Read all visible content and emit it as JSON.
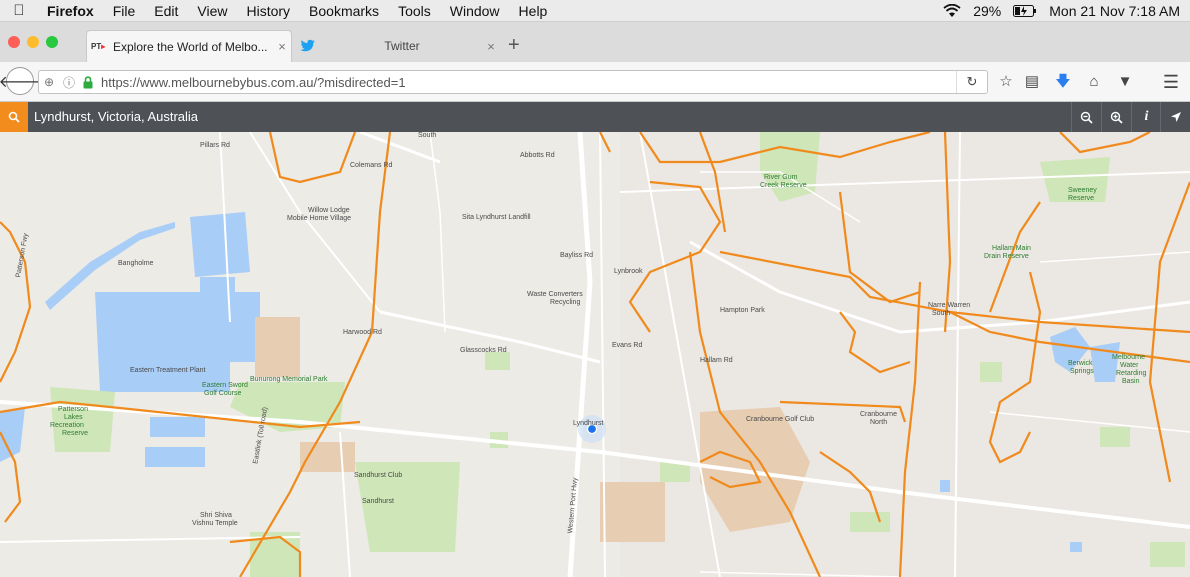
{
  "menubar": {
    "app": "Firefox",
    "items": [
      "File",
      "Edit",
      "View",
      "History",
      "Bookmarks",
      "Tools",
      "Window",
      "Help"
    ],
    "battery": "29%",
    "datetime": "Mon 21 Nov  7:18 AM"
  },
  "tabs": [
    {
      "title": "Explore the World of Melbo...",
      "favicon": "PT",
      "close": "×"
    },
    {
      "title": "Twitter",
      "favicon": "twitter-bird",
      "close": "×"
    }
  ],
  "newtab": "+",
  "navbar": {
    "url_host": "https://www.melbournebybus.com.au",
    "url_path": "/?misdirected=1"
  },
  "site": {
    "location": "Lyndhurst, Victoria, Australia"
  },
  "map": {
    "labels": {
      "willow_lodge": "Willow Lodge",
      "mobile_home": "Mobile Home Village",
      "sita": "Sita Lyndhurst Landfill",
      "bangholme": "Bangholme",
      "waste_converters": "Waste Converters",
      "recycling": "Recycling",
      "lynbrook": "Lynbrook",
      "hampton_park": "Hampton Park",
      "river_gum": "River Gum",
      "creek_reserve": "Creek Reserve",
      "sweeney": "Sweeney",
      "reserve": "Reserve",
      "hallam_main": "Hallam Main",
      "drain_reserve": "Drain Reserve",
      "narre_warren": "Narre Warren",
      "south": "South",
      "berwick_springs": "Berwick",
      "springs": "Springs",
      "melbourne_water": "Melbourne",
      "water": "Water",
      "retarding": "Retarding",
      "basin": "Basin",
      "eastern_treatment": "Eastern Treatment Plant",
      "eastern_sword": "Eastern Sword",
      "golf_course": "Golf Course",
      "bunurong": "Bunurong Memorial Park",
      "patterson_lakes": "Patterson",
      "lakes": "Lakes",
      "recreation": "Recreation",
      "reserve2": "Reserve",
      "lyndhurst": "Lyndhurst",
      "cranbourne_golf": "Cranbourne Golf Club",
      "cranbourne_north": "Cranbourne",
      "north": "North",
      "sandhurst_club": "Sandhurst Club",
      "sandhurst": "Sandhurst",
      "shri_shiva": "Shri Shiva",
      "vishnu_temple": "Vishnu Temple",
      "south_top": "South",
      "glasscocks": "Glasscocks Rd",
      "harwood": "Harwood Rd",
      "eastlink": "Eastlink (Toll road)",
      "western_port": "Western Port Hwy",
      "evans": "Evans Rd",
      "hallam": "Hallam Rd",
      "patterson": "Patterson Fwy",
      "abbotts": "Abbotts Rd",
      "colemans": "Colemans Rd",
      "bayliss": "Bayliss Rd",
      "pillars": "Pillars Rd"
    }
  },
  "colors": {
    "route": "#f08a1c",
    "water": "#a8cdf7",
    "park": "#cfe6b8",
    "land": "#ecebe6",
    "road": "#ffffff",
    "urban": "#ead6c4",
    "location_dot": "#1a73e8"
  }
}
